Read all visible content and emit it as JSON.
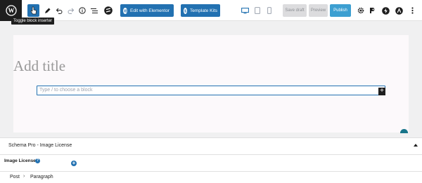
{
  "toolbar": {
    "tooltip": "Toggle block inserter",
    "elementor_label": "Edit with Elementor",
    "template_kits_label": "Template Kits",
    "save_draft_label": "Save draft",
    "preview_label": "Preview",
    "publish_label": "Publish"
  },
  "editor": {
    "title_placeholder": "Add title",
    "block_placeholder": "Type / to choose a block"
  },
  "metabox": {
    "title": "Schema Pro - Image License",
    "field_label": "Image License"
  },
  "breadcrumb": {
    "items": [
      "Post",
      "Paragraph"
    ]
  },
  "colors": {
    "accent": "#2271b1",
    "publish": "#3c9fd1",
    "dark": "#1e1e1e"
  }
}
